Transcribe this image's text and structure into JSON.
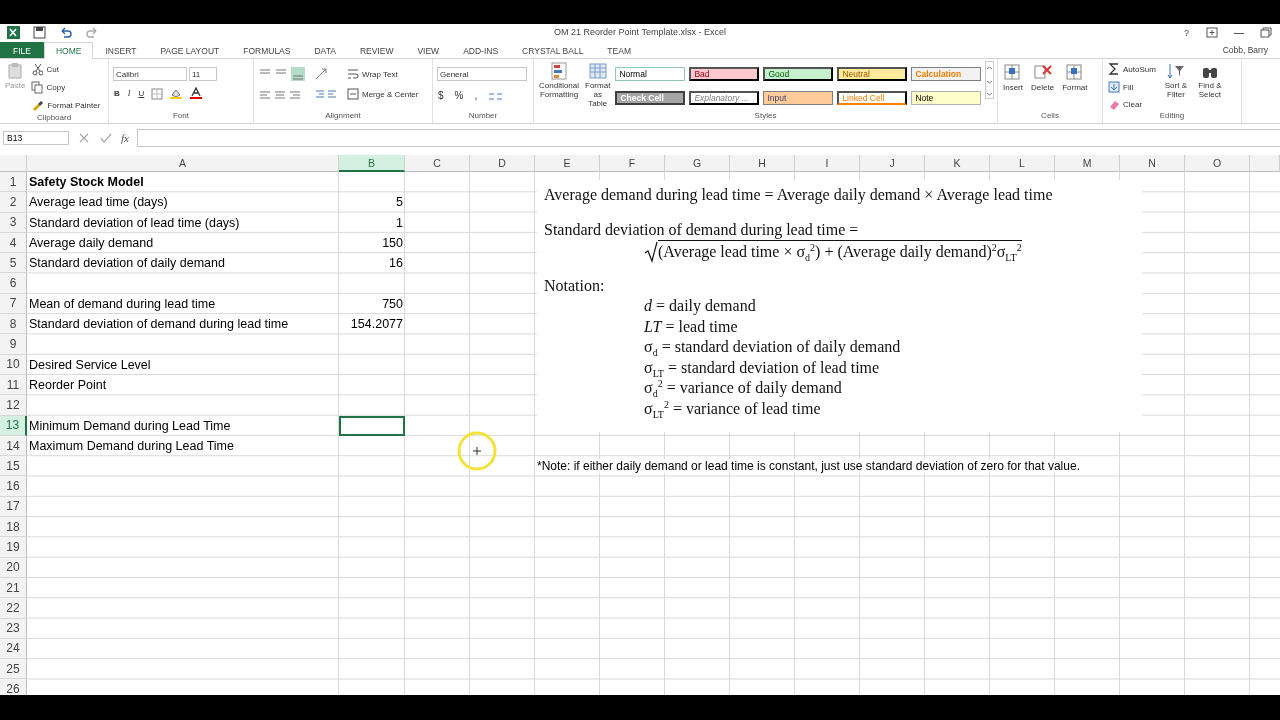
{
  "window": {
    "title": "OM 21 Reorder Point Template.xlsx - Excel",
    "user": "Cobb, Barry",
    "help": "?"
  },
  "tabs": [
    {
      "label": "FILE",
      "kind": "file",
      "selected": false
    },
    {
      "label": "HOME",
      "kind": "tab",
      "selected": true
    },
    {
      "label": "INSERT",
      "kind": "tab",
      "selected": false
    },
    {
      "label": "PAGE LAYOUT",
      "kind": "tab",
      "selected": false
    },
    {
      "label": "FORMULAS",
      "kind": "tab",
      "selected": false
    },
    {
      "label": "DATA",
      "kind": "tab",
      "selected": false
    },
    {
      "label": "REVIEW",
      "kind": "tab",
      "selected": false
    },
    {
      "label": "VIEW",
      "kind": "tab",
      "selected": false
    },
    {
      "label": "ADD-INS",
      "kind": "tab",
      "selected": false
    },
    {
      "label": "CRYSTAL BALL",
      "kind": "tab",
      "selected": false
    },
    {
      "label": "TEAM",
      "kind": "tab",
      "selected": false
    }
  ],
  "ribbon": {
    "clipboard": {
      "label": "Clipboard",
      "paste": "Paste",
      "cut": "Cut",
      "copy": "Copy",
      "format_painter": "Format Painter"
    },
    "font": {
      "label": "Font",
      "font_name": "Calibri",
      "font_size": "11",
      "bold": "B",
      "italic": "I",
      "underline": "U"
    },
    "alignment": {
      "label": "Alignment",
      "wrap_text": "Wrap Text",
      "merge": "Merge & Center"
    },
    "number": {
      "label": "Number",
      "format": "General",
      "currency": "$",
      "percent": "%",
      "comma": ","
    },
    "styles": {
      "label": "Styles",
      "conditional": "Conditional Formatting",
      "format_table": "Format as Table",
      "cell_styles": [
        {
          "label": "Normal",
          "kind": "normal"
        },
        {
          "label": "Bad",
          "kind": "bad"
        },
        {
          "label": "Good",
          "kind": "good"
        },
        {
          "label": "Neutral",
          "kind": "neutral"
        },
        {
          "label": "Calculation",
          "kind": "calculation"
        },
        {
          "label": "Check Cell",
          "kind": "check"
        },
        {
          "label": "Explanatory ...",
          "kind": "explanatory"
        },
        {
          "label": "Input",
          "kind": "input"
        },
        {
          "label": "Linked Cell",
          "kind": "linked"
        },
        {
          "label": "Note",
          "kind": "note"
        }
      ]
    },
    "cells": {
      "label": "Cells",
      "buttons": [
        "Insert",
        "Delete",
        "Format"
      ]
    },
    "editing": {
      "label": "Editing",
      "autosum": "AutoSum",
      "fill": "Fill",
      "clear": "Clear",
      "sort": "Sort & Filter",
      "find": "Find & Select"
    }
  },
  "formula_bar": {
    "name_box": "B13",
    "fx": "fx"
  },
  "sheet": {
    "columns": [
      {
        "label": "A",
        "selected": false
      },
      {
        "label": "B",
        "selected": true
      },
      {
        "label": "C",
        "selected": false
      },
      {
        "label": "D",
        "selected": false
      },
      {
        "label": "E",
        "selected": false
      },
      {
        "label": "F",
        "selected": false
      },
      {
        "label": "G",
        "selected": false
      },
      {
        "label": "H",
        "selected": false
      },
      {
        "label": "I",
        "selected": false
      },
      {
        "label": "J",
        "selected": false
      },
      {
        "label": "K",
        "selected": false
      },
      {
        "label": "L",
        "selected": false
      },
      {
        "label": "M",
        "selected": false
      },
      {
        "label": "N",
        "selected": false
      },
      {
        "label": "O",
        "selected": false
      }
    ],
    "rows": [
      {
        "number": "1",
        "selected": false,
        "bold": true,
        "label": "Safety Stock Model"
      },
      {
        "number": "2",
        "selected": false,
        "bold": false,
        "label": "Average lead time (days)",
        "value": "5"
      },
      {
        "number": "3",
        "selected": false,
        "bold": false,
        "label": "Standard deviation of lead time (days)",
        "value": "1"
      },
      {
        "number": "4",
        "selected": false,
        "bold": false,
        "label": "Average daily demand",
        "value": "150"
      },
      {
        "number": "5",
        "selected": false,
        "bold": false,
        "label": "Standard deviation of daily demand",
        "value": "16"
      },
      {
        "number": "6",
        "selected": false
      },
      {
        "number": "7",
        "selected": false,
        "bold": false,
        "label": "Mean of demand during lead time",
        "value": "750"
      },
      {
        "number": "8",
        "selected": false,
        "bold": false,
        "label": "Standard deviation of demand during lead time",
        "value": "154.2077"
      },
      {
        "number": "9",
        "selected": false
      },
      {
        "number": "10",
        "selected": false,
        "bold": false,
        "label": "Desired Service Level"
      },
      {
        "number": "11",
        "selected": false,
        "bold": false,
        "label": "Reorder Point"
      },
      {
        "number": "12",
        "selected": false
      },
      {
        "number": "13",
        "selected": true,
        "bold": false,
        "label": "Minimum Demand during Lead Time"
      },
      {
        "number": "14",
        "selected": false,
        "bold": false,
        "label": "Maximum Demand during Lead Time"
      },
      {
        "number": "15",
        "selected": false,
        "note": "*Note: if either daily demand or lead time is constant, just use standard deviation of zero for that value."
      },
      {
        "number": "16",
        "selected": false
      },
      {
        "number": "17",
        "selected": false
      },
      {
        "number": "18",
        "selected": false
      },
      {
        "number": "19",
        "selected": false
      },
      {
        "number": "20",
        "selected": false
      },
      {
        "number": "21",
        "selected": false
      },
      {
        "number": "22",
        "selected": false
      },
      {
        "number": "23",
        "selected": false
      },
      {
        "number": "24",
        "selected": false
      },
      {
        "number": "25",
        "selected": false
      },
      {
        "number": "26",
        "selected": false
      }
    ]
  },
  "equation": {
    "line_1": "Average demand during lead time = Average daily demand × Average lead time",
    "line_2": "Standard deviation of demand during lead time =",
    "radicand": "(Average lead time × σ$_{d}$$^{2}$) + (Average daily demand)$^{2}$σ$_{LT}$$^{2}$",
    "notation_title": "Notation:",
    "notation": [
      "*d* = daily demand",
      "*LT* = lead time",
      "σ$_{d}$ = standard deviation of daily demand",
      "σ$_{LT}$ = standard deviation of lead time",
      "σ$_{d}$$^{2}$ = variance of daily demand",
      "σ$_{LT}$$^{2}$ = variance of lead time"
    ]
  }
}
